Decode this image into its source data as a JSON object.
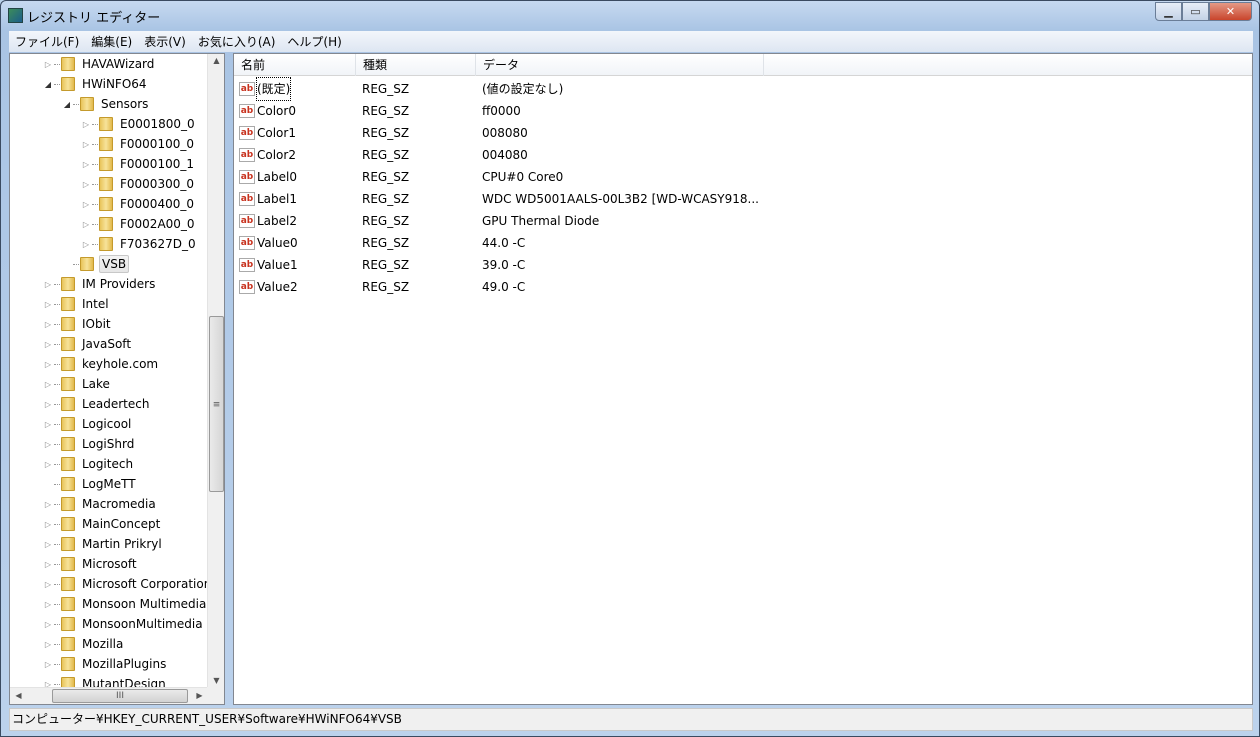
{
  "window": {
    "title": "レジストリ エディター",
    "minimize_icon": "minimize-icon",
    "maximize_icon": "maximize-icon",
    "close_icon": "close-icon"
  },
  "menu": [
    "ファイル(F)",
    "編集(E)",
    "表示(V)",
    "お気に入り(A)",
    "ヘルプ(H)"
  ],
  "tree": [
    {
      "label": "HAVAWizard",
      "level": 1,
      "expander": "hover"
    },
    {
      "label": "HWiNFO64",
      "level": 1,
      "expander": "open"
    },
    {
      "label": "Sensors",
      "level": 2,
      "expander": "open"
    },
    {
      "label": "E0001800_0",
      "level": 3,
      "expander": "closed"
    },
    {
      "label": "F0000100_0",
      "level": 3,
      "expander": "closed"
    },
    {
      "label": "F0000100_1",
      "level": 3,
      "expander": "closed"
    },
    {
      "label": "F0000300_0",
      "level": 3,
      "expander": "closed"
    },
    {
      "label": "F0000400_0",
      "level": 3,
      "expander": "closed"
    },
    {
      "label": "F0002A00_0",
      "level": 3,
      "expander": "closed"
    },
    {
      "label": "F703627D_0",
      "level": 3,
      "expander": "closed"
    },
    {
      "label": "VSB",
      "level": 2,
      "expander": "none",
      "selected": true
    },
    {
      "label": "IM Providers",
      "level": 1,
      "expander": "closed"
    },
    {
      "label": "Intel",
      "level": 1,
      "expander": "closed"
    },
    {
      "label": "IObit",
      "level": 1,
      "expander": "closed"
    },
    {
      "label": "JavaSoft",
      "level": 1,
      "expander": "closed"
    },
    {
      "label": "keyhole.com",
      "level": 1,
      "expander": "closed"
    },
    {
      "label": "Lake",
      "level": 1,
      "expander": "closed"
    },
    {
      "label": "Leadertech",
      "level": 1,
      "expander": "closed"
    },
    {
      "label": "Logicool",
      "level": 1,
      "expander": "closed"
    },
    {
      "label": "LogiShrd",
      "level": 1,
      "expander": "closed"
    },
    {
      "label": "Logitech",
      "level": 1,
      "expander": "closed"
    },
    {
      "label": "LogMeTT",
      "level": 1,
      "expander": "none"
    },
    {
      "label": "Macromedia",
      "level": 1,
      "expander": "closed"
    },
    {
      "label": "MainConcept",
      "level": 1,
      "expander": "closed"
    },
    {
      "label": "Martin Prikryl",
      "level": 1,
      "expander": "closed"
    },
    {
      "label": "Microsoft",
      "level": 1,
      "expander": "closed"
    },
    {
      "label": "Microsoft Corporation",
      "level": 1,
      "expander": "closed"
    },
    {
      "label": "Monsoon Multimedia",
      "level": 1,
      "expander": "closed"
    },
    {
      "label": "MonsoonMultimedia",
      "level": 1,
      "expander": "closed"
    },
    {
      "label": "Mozilla",
      "level": 1,
      "expander": "closed"
    },
    {
      "label": "MozillaPlugins",
      "level": 1,
      "expander": "closed"
    },
    {
      "label": "MutantDesign",
      "level": 1,
      "expander": "closed"
    }
  ],
  "list": {
    "columns": [
      "名前",
      "種類",
      "データ"
    ],
    "rows": [
      {
        "name": "(既定)",
        "type": "REG_SZ",
        "data": "(値の設定なし)"
      },
      {
        "name": "Color0",
        "type": "REG_SZ",
        "data": "ff0000"
      },
      {
        "name": "Color1",
        "type": "REG_SZ",
        "data": "008080"
      },
      {
        "name": "Color2",
        "type": "REG_SZ",
        "data": "004080"
      },
      {
        "name": "Label0",
        "type": "REG_SZ",
        "data": "CPU#0 Core0"
      },
      {
        "name": "Label1",
        "type": "REG_SZ",
        "data": "WDC WD5001AALS-00L3B2 [WD-WCASY918..."
      },
      {
        "name": "Label2",
        "type": "REG_SZ",
        "data": "GPU Thermal Diode"
      },
      {
        "name": "Value0",
        "type": "REG_SZ",
        "data": "44.0 -C"
      },
      {
        "name": "Value1",
        "type": "REG_SZ",
        "data": "39.0 -C"
      },
      {
        "name": "Value2",
        "type": "REG_SZ",
        "data": "49.0 -C"
      }
    ],
    "value_icon_text": "ab"
  },
  "status": "コンピューター¥HKEY_CURRENT_USER¥Software¥HWiNFO64¥VSB"
}
